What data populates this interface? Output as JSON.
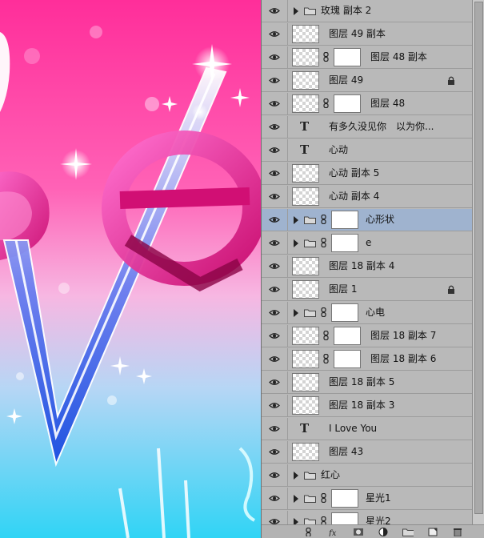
{
  "panel": {
    "layers": [
      {
        "type": "group",
        "name": "玫瑰 副本 2",
        "selected": false
      },
      {
        "type": "pixel",
        "name": "图层 49 副本",
        "selected": false
      },
      {
        "type": "masked",
        "name": "图层 48 副本",
        "selected": false
      },
      {
        "type": "pixel",
        "name": "图层 49",
        "locked": true,
        "selected": false
      },
      {
        "type": "masked",
        "name": "图层 48",
        "selected": false
      },
      {
        "type": "text",
        "name": "有多久没见你　以为你...",
        "selected": false
      },
      {
        "type": "text",
        "name": "心动",
        "selected": false
      },
      {
        "type": "pixel",
        "name": "心动 副本 5",
        "selected": false
      },
      {
        "type": "pixel",
        "name": "心动 副本 4",
        "selected": false
      },
      {
        "type": "group-masked",
        "name": "心形状",
        "selected": true
      },
      {
        "type": "group-masked",
        "name": "e",
        "selected": false
      },
      {
        "type": "pixel",
        "name": "图层 18 副本 4",
        "selected": false
      },
      {
        "type": "pixel",
        "name": "图层 1",
        "locked": true,
        "selected": false
      },
      {
        "type": "group-masked",
        "name": "心电",
        "selected": false
      },
      {
        "type": "masked-pixel",
        "name": "图层 18 副本 7",
        "selected": false
      },
      {
        "type": "masked-pixel",
        "name": "图层 18 副本 6",
        "selected": false
      },
      {
        "type": "pixel",
        "name": "图层 18 副本 5",
        "selected": false
      },
      {
        "type": "pixel",
        "name": "图层 18 副本 3",
        "selected": false
      },
      {
        "type": "text",
        "name": "I Love You",
        "selected": false
      },
      {
        "type": "pixel",
        "name": "图层 43",
        "selected": false
      },
      {
        "type": "group",
        "name": "红心",
        "selected": false
      },
      {
        "type": "group-masked",
        "name": "星光1",
        "selected": false
      },
      {
        "type": "group-masked",
        "name": "星光2",
        "selected": false
      }
    ],
    "icons": {
      "visibility": "eye-icon",
      "expand": "disclosure-arrow-icon",
      "group": "folder-icon",
      "link": "chain-link-icon",
      "text": "type-layer-icon",
      "lock": "lock-icon"
    },
    "footer_icons": [
      "link-layers-icon",
      "fx-icon",
      "add-mask-icon",
      "adjustment-layer-icon",
      "new-group-icon",
      "new-layer-icon",
      "delete-layer-icon"
    ]
  },
  "colors": {
    "panel_bg": "#b9b9b9",
    "selected_row": "#9fb3cf",
    "canvas_pink": "#ff1e8c",
    "canvas_cyan": "#2fd2f5"
  }
}
